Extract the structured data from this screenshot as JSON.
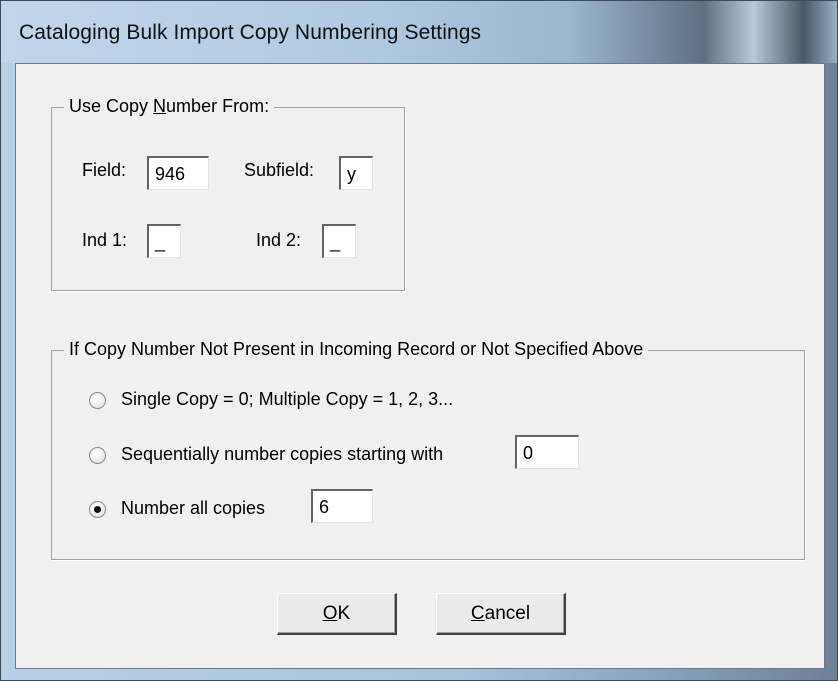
{
  "window": {
    "title": "Cataloging Bulk Import Copy Numbering Settings"
  },
  "copy_number_from": {
    "legend_pre": "Use Copy ",
    "legend_accel": "N",
    "legend_post": "umber From:",
    "field_label": "Field:",
    "field_value": "946",
    "subfield_label": "Subfield:",
    "subfield_value": "y",
    "ind1_label": "Ind 1:",
    "ind1_value": "_",
    "ind2_label": "Ind 2:",
    "ind2_value": "_"
  },
  "fallback": {
    "legend": "If Copy Number Not Present in Incoming Record or Not Specified Above",
    "options": [
      {
        "label": "Single Copy = 0; Multiple Copy = 1, 2, 3...",
        "selected": false
      },
      {
        "label": "Sequentially number copies starting with",
        "selected": false,
        "value": "0"
      },
      {
        "label": "Number all copies",
        "selected": true,
        "value": "6"
      }
    ]
  },
  "buttons": {
    "ok_accel": "O",
    "ok_rest": "K",
    "cancel_accel": "C",
    "cancel_rest": "ancel"
  }
}
